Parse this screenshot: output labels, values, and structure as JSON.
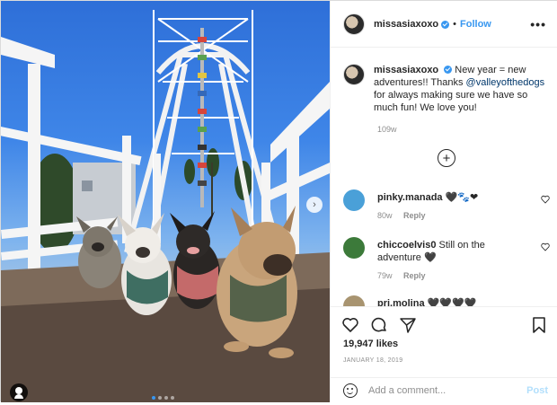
{
  "post": {
    "username": "missasiaxoxo",
    "follow_label": "Follow",
    "separator": "•",
    "more_label": "•••",
    "caption_text_before": "New year = new adventures!! Thanks ",
    "caption_mention": "@valleyofthedogs",
    "caption_text_after": " for always making sure we have so much fun! We love you!",
    "caption_time": "109w",
    "load_more_label": "+"
  },
  "comments": [
    {
      "username": "pinky.manada",
      "text": "🖤🐾❤",
      "time": "80w",
      "reply_label": "Reply",
      "avatar_color": "#4aa0d8"
    },
    {
      "username": "chiccoelvis0",
      "text": "Still on the adventure 🖤",
      "time": "79w",
      "reply_label": "Reply",
      "avatar_color": "#3c7a3a"
    },
    {
      "username": "pri.molina",
      "text": "🖤🖤🖤🖤",
      "time": "",
      "reply_label": "",
      "avatar_color": "#a89470"
    }
  ],
  "footer": {
    "likes": "19,947 likes",
    "date": "JANUARY 18, 2019",
    "comment_placeholder": "Add a comment...",
    "post_label": "Post"
  },
  "icons": {
    "like": "heart-icon",
    "comment": "comment-icon",
    "share": "paper-plane-icon",
    "save": "bookmark-icon",
    "more": "more-options-icon",
    "verified": "verified-badge-icon",
    "emoji": "emoji-icon",
    "next": "chevron-right-icon",
    "tag": "user-tag-icon"
  },
  "colors": {
    "link": "#3897f0",
    "mention": "#00376b",
    "secondary_text": "#8e8e8e"
  },
  "carousel": {
    "slide_count": 4,
    "current_slide": 1
  }
}
